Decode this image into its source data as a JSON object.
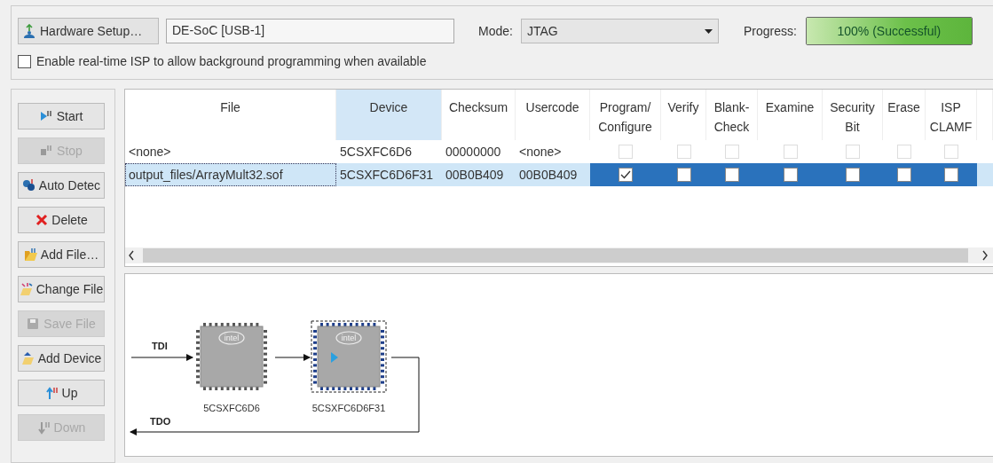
{
  "toolbar": {
    "hardware_button": "Hardware Setup…",
    "hardware_field": {
      "value": "DE-SoC [USB-1]"
    },
    "mode": {
      "label": "Mode:",
      "value": "JTAG"
    },
    "progress": {
      "label": "Progress:",
      "text": "100% (Successful)",
      "level": 1
    },
    "isp_checkbox": {
      "label": "Enable real-time ISP to allow background programming when available",
      "checked": false
    }
  },
  "actions": [
    {
      "label": "Start",
      "kind": "start",
      "disabled": false
    },
    {
      "label": "Stop",
      "kind": "stop",
      "disabled": true
    },
    {
      "label": "Auto Detec",
      "kind": "detect",
      "disabled": false
    },
    {
      "label": "Delete",
      "kind": "delete",
      "disabled": false
    },
    {
      "label": "Add File…",
      "kind": "add-file",
      "disabled": false
    },
    {
      "label": "Change File",
      "kind": "change-file",
      "disabled": false
    },
    {
      "label": "Save File",
      "kind": "save",
      "disabled": true
    },
    {
      "label": "Add Device",
      "kind": "add-device",
      "disabled": false
    },
    {
      "label": "Up",
      "kind": "up",
      "disabled": false
    },
    {
      "label": "Down",
      "kind": "down",
      "disabled": true
    }
  ],
  "table": {
    "columns": [
      {
        "label": "File",
        "highlighted": false
      },
      {
        "label": "Device",
        "highlighted": true
      },
      {
        "label": "Checksum",
        "highlighted": false
      },
      {
        "label": "Usercode",
        "highlighted": false
      },
      {
        "label": "Program/ Configure",
        "highlighted": false
      },
      {
        "label": "Verify",
        "highlighted": false
      },
      {
        "label": "Blank- Check",
        "highlighted": false
      },
      {
        "label": "Examine",
        "highlighted": false
      },
      {
        "label": "Security Bit",
        "highlighted": false
      },
      {
        "label": "Erase",
        "highlighted": false
      },
      {
        "label": "ISP CLAMF",
        "highlighted": false
      }
    ],
    "rows": [
      {
        "selected": false,
        "cells": [
          "<none>",
          "5CSXFC6D6",
          "00000000",
          "<none>"
        ],
        "options": [
          {
            "checked": false,
            "disabled": true
          },
          {
            "checked": false,
            "disabled": true
          },
          {
            "checked": false,
            "disabled": true
          },
          {
            "checked": false,
            "disabled": true
          },
          {
            "checked": false,
            "disabled": true
          },
          {
            "checked": false,
            "disabled": true
          },
          {
            "checked": false,
            "disabled": true
          }
        ]
      },
      {
        "selected": true,
        "cells": [
          "output_files/ArrayMult32.sof",
          "5CSXFC6D6F31",
          "00B0B409",
          "00B0B409"
        ],
        "options": [
          {
            "checked": true,
            "disabled": false
          },
          {
            "checked": false,
            "disabled": false
          },
          {
            "checked": false,
            "disabled": false
          },
          {
            "checked": false,
            "disabled": false
          },
          {
            "checked": false,
            "disabled": false
          },
          {
            "checked": false,
            "disabled": false
          },
          {
            "checked": false,
            "disabled": false
          }
        ]
      }
    ]
  },
  "chain": {
    "tdi_label": "TDI",
    "tdo_label": "TDO",
    "devices": [
      {
        "name": "5CSXFC6D6",
        "logo": "intel",
        "selected": false,
        "has_file": false
      },
      {
        "name": "5CSXFC6D6F31",
        "logo": "intel",
        "selected": true,
        "has_file": true
      }
    ]
  }
}
